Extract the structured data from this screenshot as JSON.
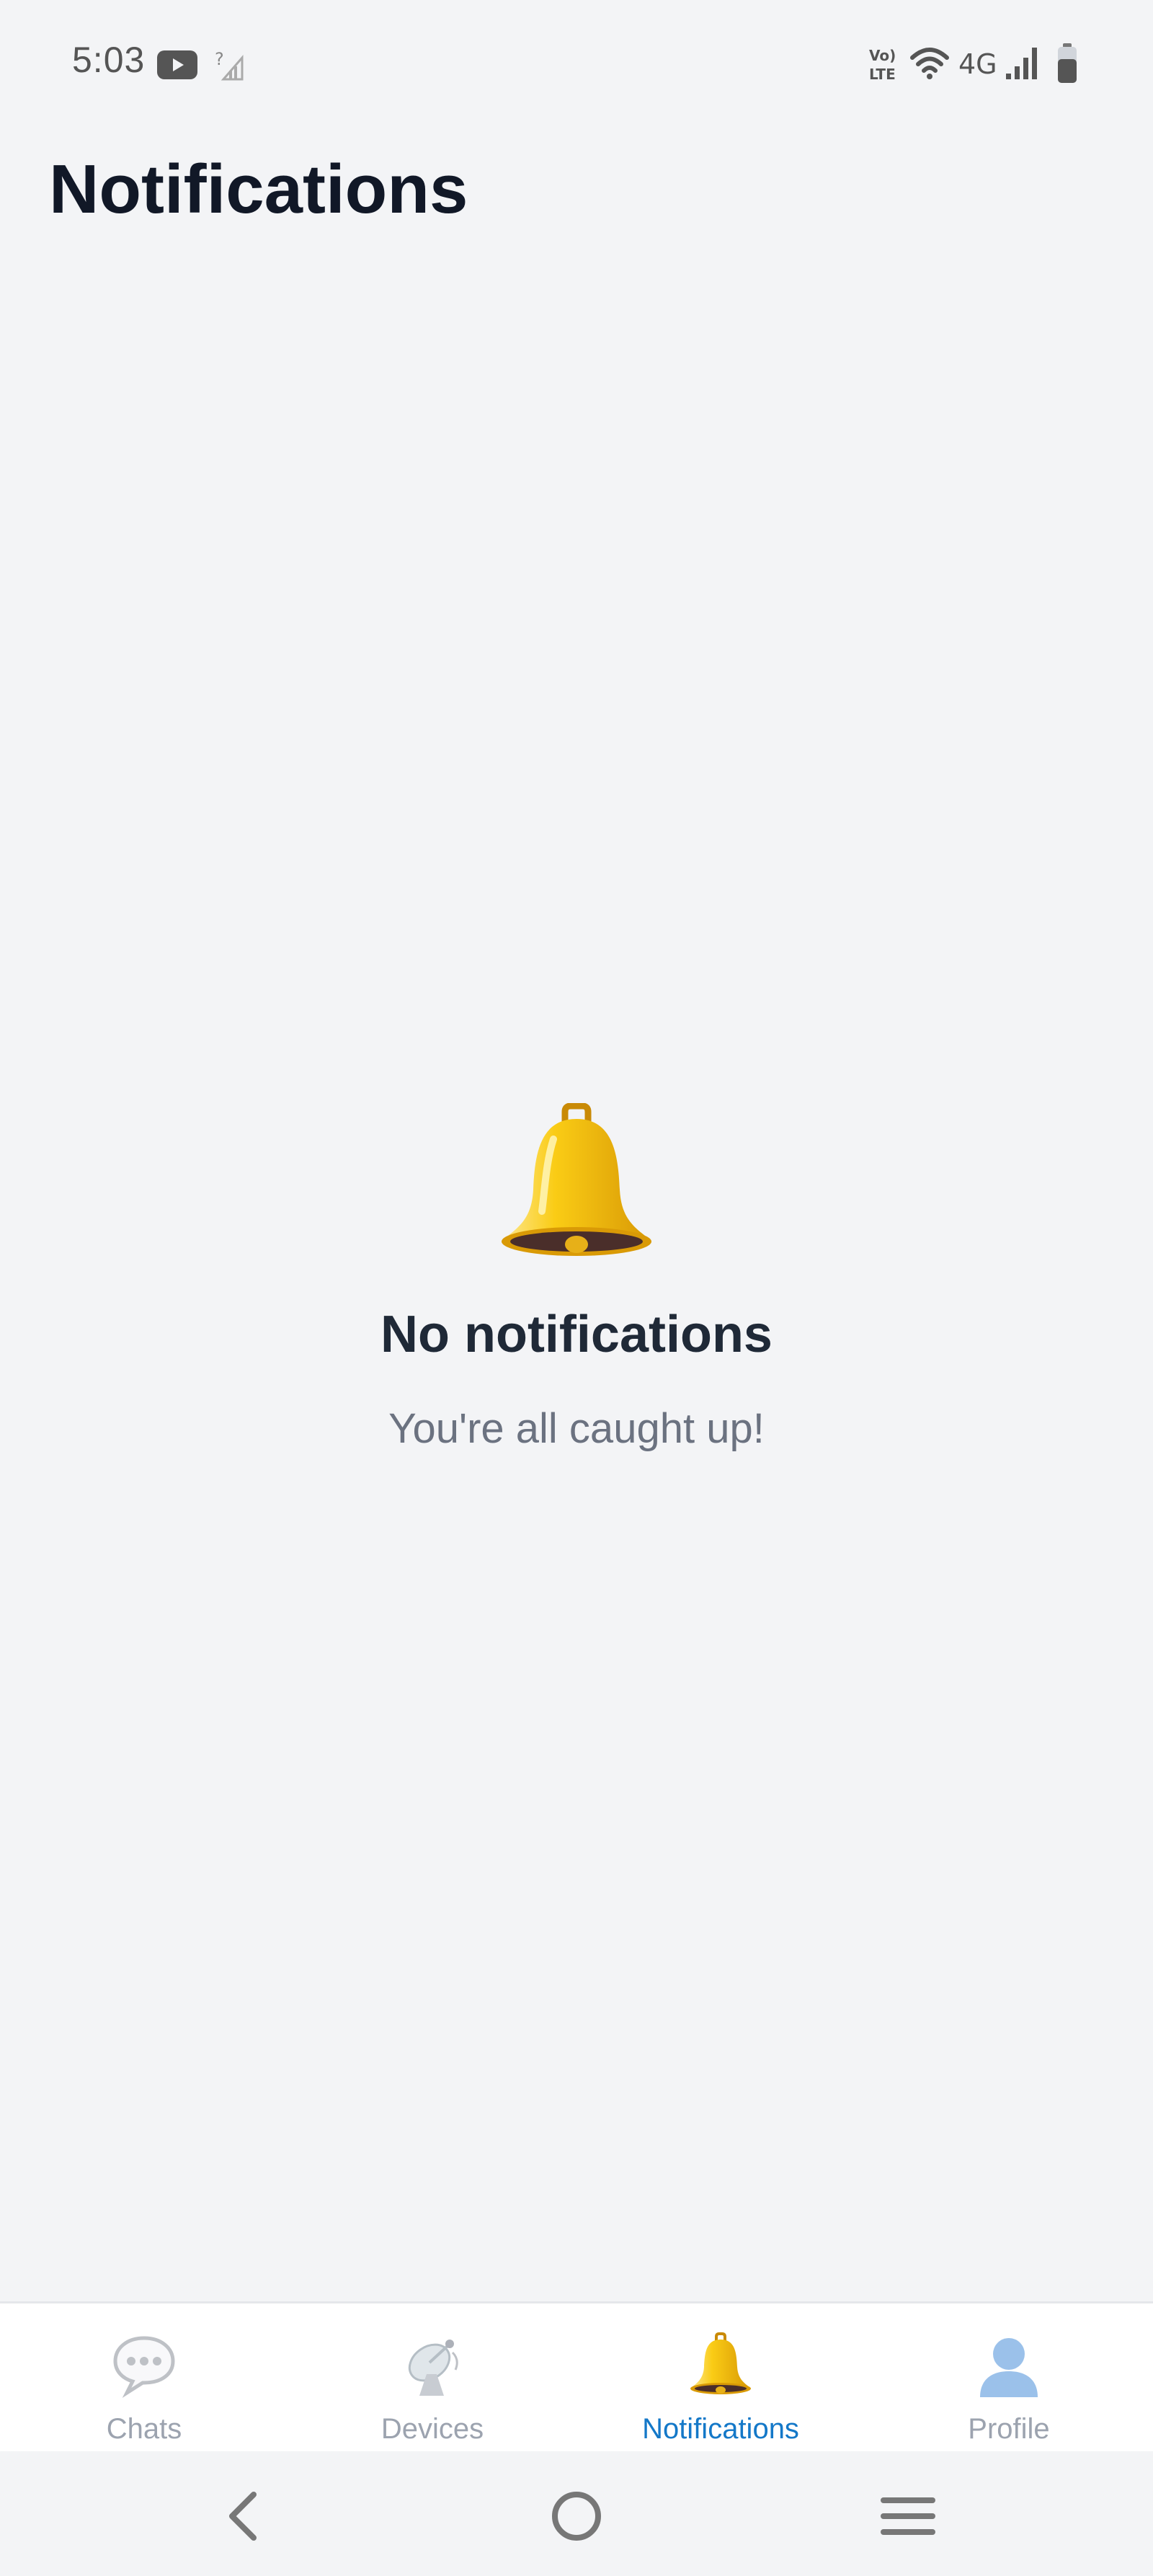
{
  "status_bar": {
    "time": "5:03",
    "icons": [
      "youtube-icon",
      "no-sim-signal-icon",
      "volte-icon",
      "wifi-icon",
      "network-4g-icon",
      "cell-signal-icon",
      "battery-icon"
    ],
    "network_label": "4G",
    "volte_label_top": "Vo)",
    "volte_label_bottom": "LTE"
  },
  "header": {
    "title": "Notifications"
  },
  "empty_state": {
    "icon": "bell-icon",
    "title": "No notifications",
    "subtitle": "You're all caught up!"
  },
  "bottom_nav": {
    "active_color": "#1478C8",
    "inactive_color": "#9CA3AF",
    "items": [
      {
        "label": "Chats",
        "icon": "speech-bubble-icon"
      },
      {
        "label": "Devices",
        "icon": "satellite-dish-icon"
      },
      {
        "label": "Notifications",
        "icon": "bell-icon",
        "active": true
      },
      {
        "label": "Profile",
        "icon": "user-silhouette-icon"
      }
    ]
  },
  "system_nav": {
    "buttons": [
      "back-icon",
      "home-icon",
      "recents-menu-icon"
    ]
  }
}
